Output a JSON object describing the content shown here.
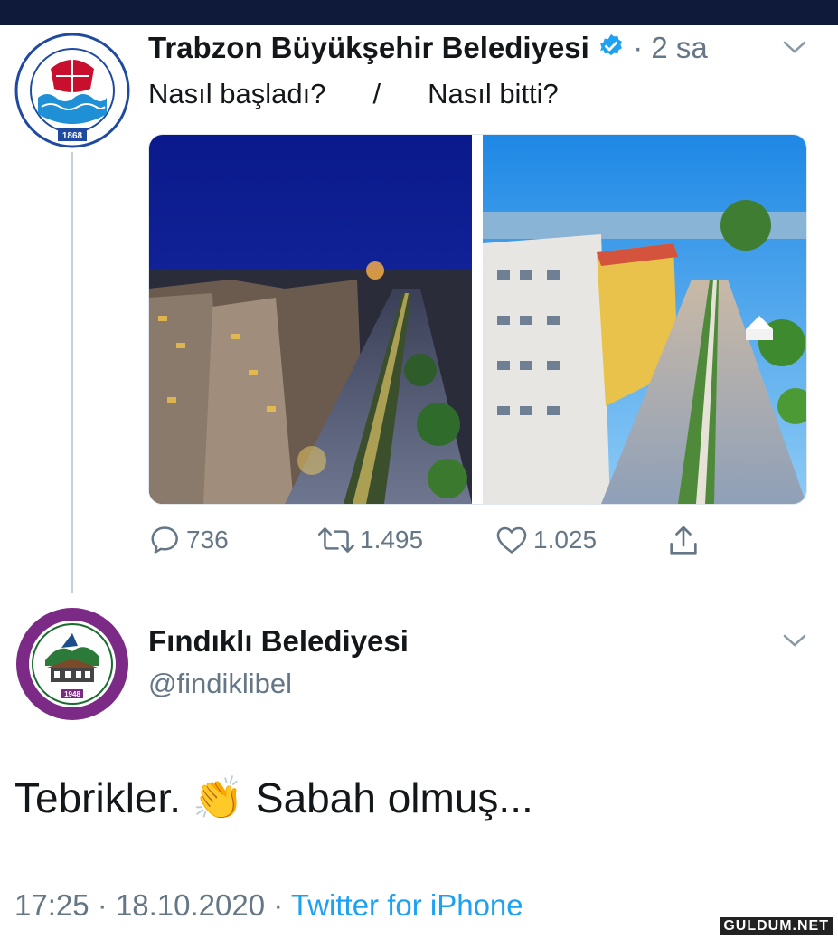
{
  "tweet": {
    "author_name": "Trabzon Büyükşehir Belediyesi",
    "time_sep": "·",
    "time": "2 sa",
    "text_left": "Nasıl başladı?",
    "text_slash": "/",
    "text_right": "Nasıl bitti?",
    "avatar_text_top": "TRABZON BÜYÜKŞEHİR BELEDİYESİ",
    "avatar_year": "1868",
    "images": [
      {
        "icon": "night-city-photo"
      },
      {
        "icon": "day-city-photo"
      }
    ],
    "actions": {
      "replies": "736",
      "retweets": "1.495",
      "likes": "1.025"
    }
  },
  "reply": {
    "author_name": "Fındıklı Belediyesi",
    "handle": "@findiklibel",
    "avatar_text_top": "İSTANBUL SÖZLEŞMESİ YAŞATIR",
    "avatar_text_inner": "T.C. FINDIKLI BELEDİYESİ",
    "avatar_text_bottom": "TCK-103  6284'Ü UYGULA",
    "avatar_year": "1948",
    "text_before": "Tebrikler.",
    "emoji": "👏",
    "text_after": "Sabah olmuş...",
    "time": "17:25",
    "sep": "·",
    "date": "18.10.2020",
    "source": "Twitter for iPhone"
  },
  "watermark": "GULDUM.NET",
  "colors": {
    "link": "#1da1f2",
    "muted": "#657786",
    "topbar": "#0f1a3a",
    "thread_line": "#c4cfd6"
  }
}
